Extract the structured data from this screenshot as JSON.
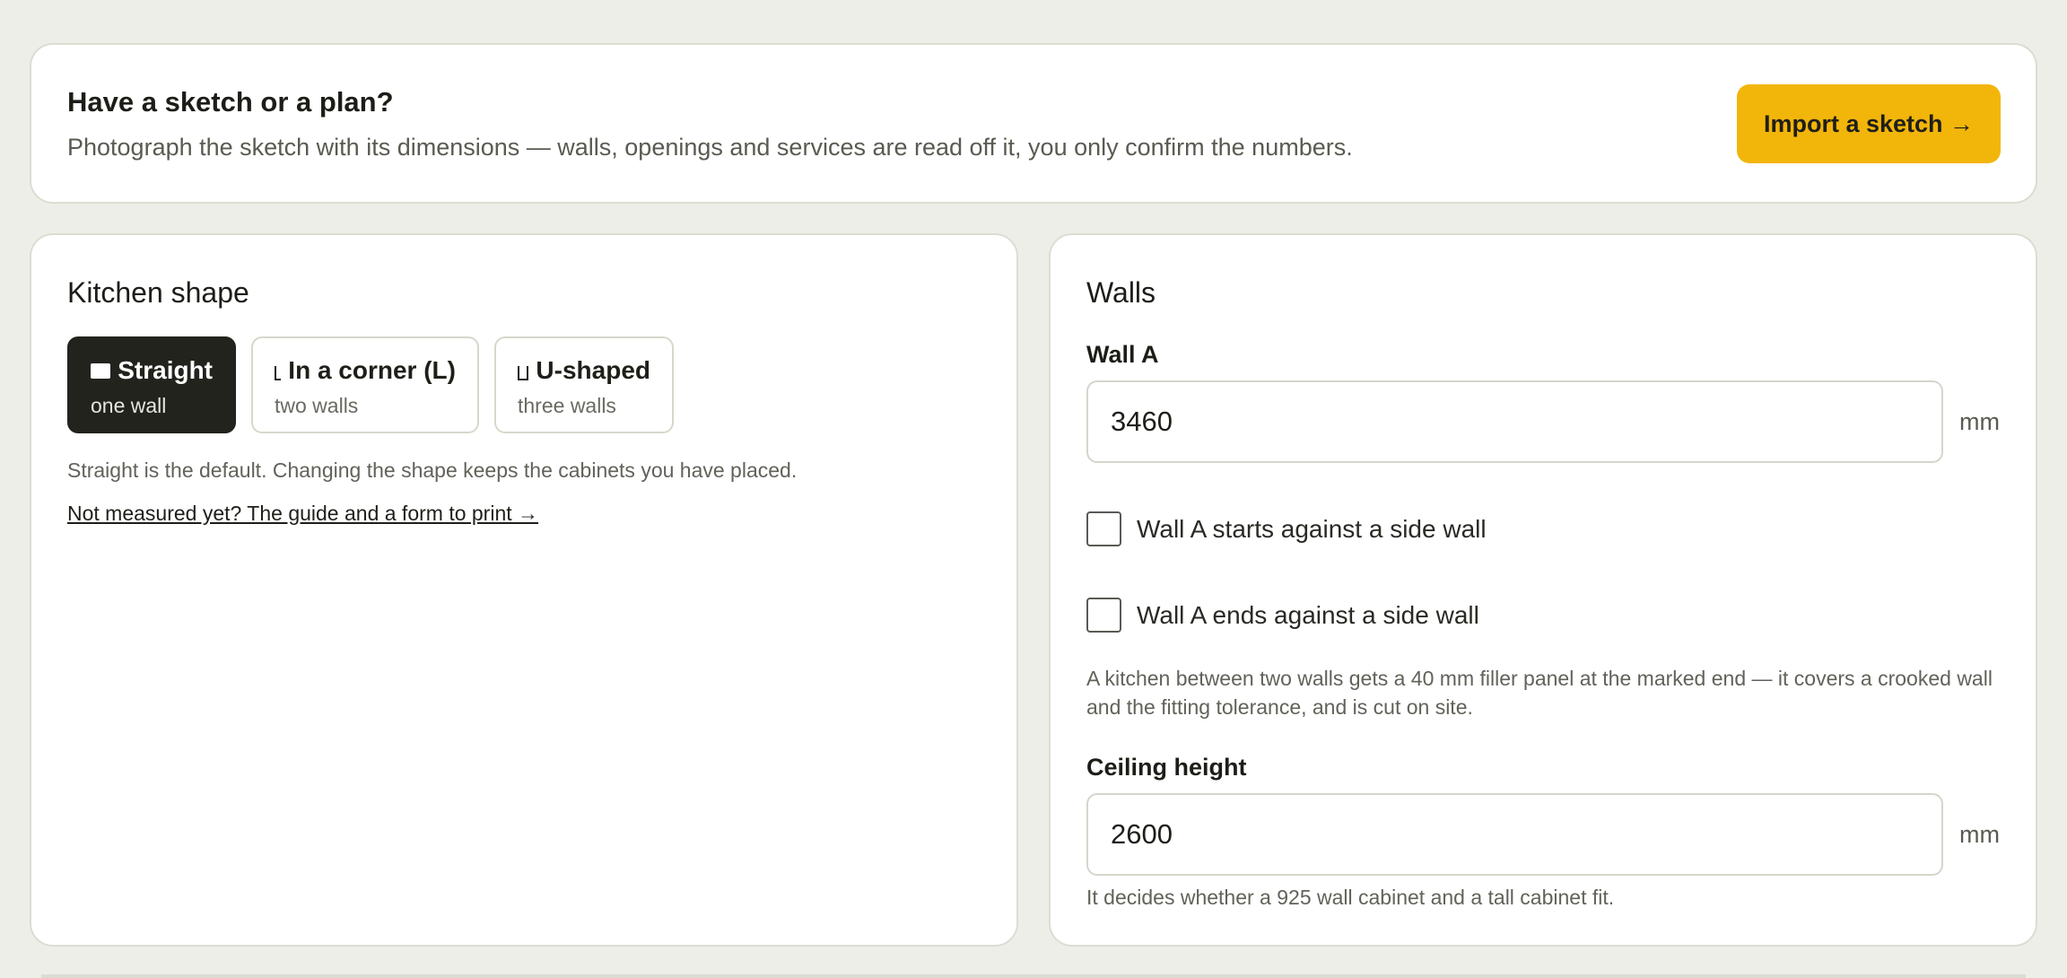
{
  "banner": {
    "title": "Have a sketch or a plan?",
    "subtitle": "Photograph the sketch with its dimensions — walls, openings and services are read off it, you only confirm the numbers.",
    "import_label": "Import a sketch →"
  },
  "shape": {
    "title": "Kitchen shape",
    "options": [
      {
        "label": "Straight",
        "sub": "one wall",
        "icon": "rectangle-icon",
        "selected": true
      },
      {
        "label": "In a corner (L)",
        "sub": "two walls",
        "icon": "corner-l-icon",
        "selected": false
      },
      {
        "label": "U-shaped",
        "sub": "three walls",
        "icon": "u-shape-icon",
        "selected": false
      }
    ],
    "note": "Straight is the default. Changing the shape keeps the cabinets you have placed.",
    "guide_link": "Not measured yet? The guide and a form to print →"
  },
  "walls": {
    "title": "Walls",
    "wall_a": {
      "label": "Wall A",
      "value": "3460",
      "unit": "mm"
    },
    "starts_label": "Wall A starts against a side wall",
    "starts_checked": false,
    "ends_label": "Wall A ends against a side wall",
    "ends_checked": false,
    "filler_note": "A kitchen between two walls gets a 40 mm filler panel at the marked end — it covers a crooked wall and the fitting tolerance, and is cut on site.",
    "ceiling": {
      "label": "Ceiling height",
      "value": "2600",
      "unit": "mm"
    },
    "ceiling_note": "It decides whether a 925 wall cabinet and a tall cabinet fit."
  },
  "colors": {
    "accent": "#f2b50a",
    "selected_option": "#23231e",
    "background": "#eeeee9"
  }
}
